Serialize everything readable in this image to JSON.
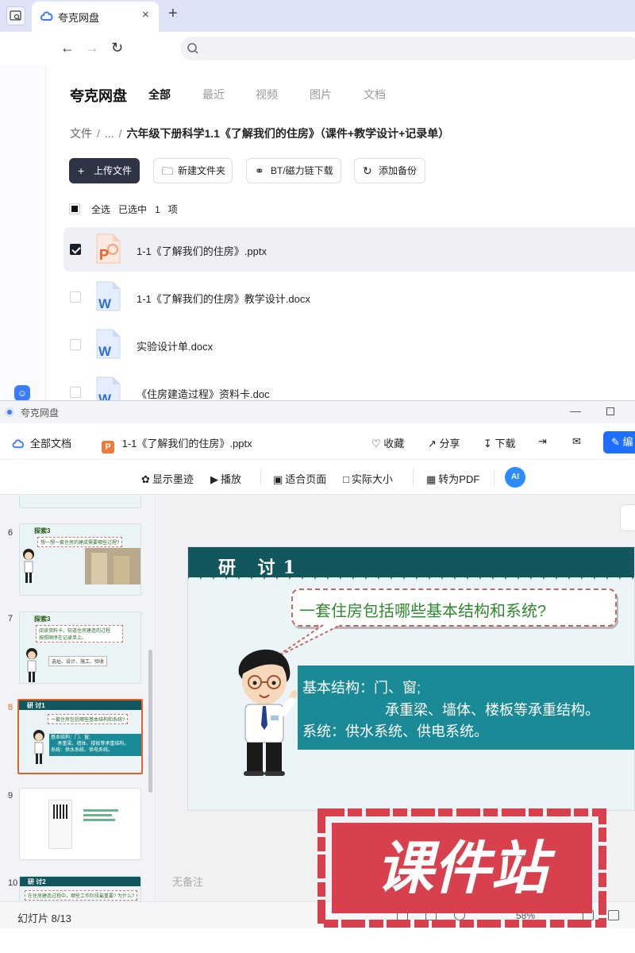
{
  "browser": {
    "tab_title": "夸克网盘",
    "new_tab": "+",
    "close": "×"
  },
  "drive": {
    "brand": "夸克网盘",
    "nav": [
      "全部",
      "最近",
      "视频",
      "图片",
      "文档"
    ],
    "breadcrumb": {
      "root": "文件",
      "mid": "...",
      "current": "六年级下册科学1.1《了解我们的住房》（课件+教学设计+记录单）"
    },
    "actions": {
      "upload": "上传文件",
      "new_folder": "新建文件夹",
      "bt": "BT/磁力链下载",
      "backup": "添加备份"
    },
    "selection": {
      "select_all": "全选",
      "selected": "已选中",
      "count": "1",
      "unit": "项"
    },
    "files": [
      {
        "name": "1-1《了解我们的住房》.pptx",
        "type": "pptx",
        "checked": true
      },
      {
        "name": "1-1《了解我们的住房》教学设计.docx",
        "type": "docx",
        "checked": false
      },
      {
        "name": "实验设计单.docx",
        "type": "docx",
        "checked": false
      },
      {
        "name": "《住房建造过程》资料卡.doc",
        "type": "doc",
        "checked": false
      }
    ]
  },
  "viewer": {
    "window_title": "夸克网盘",
    "all_docs": "全部文档",
    "file_name": "1-1《了解我们的住房》.pptx",
    "file_badge": "P",
    "favorite": "收藏",
    "share": "分享",
    "download": "下载",
    "edit": "编",
    "tools": {
      "ink": "显示墨迹",
      "play": "播放",
      "fit": "适合页面",
      "actual": "实际大小",
      "pdf": "转为PDF",
      "ai": "AI"
    },
    "thumbnails": [
      {
        "num": "6",
        "title": "探索3",
        "bubble": "想一想一套住房的建成需要哪些过程?"
      },
      {
        "num": "7",
        "title": "探索3",
        "bubble": "阅读资料卡，知道住房建造的过程",
        "bubble2": "按照顺序在记录单上。",
        "tag": "选址、设计、施工、验收"
      },
      {
        "num": "8",
        "title": "研 讨1",
        "bubble": "一套住房包括哪些基本结构和系统?",
        "ans1": "基本结构：门、窗;",
        "ans2": "承重梁、墙体、楼板等承重结构。",
        "ans3": "系统：供水系统、供电系统。"
      },
      {
        "num": "9"
      },
      {
        "num": "10",
        "title": "研 讨2",
        "bubble": "在住房建造过程中，哪些工作阶段最重要? 为什么?"
      }
    ],
    "slide": {
      "title": "研 讨1",
      "question": "一套住房包括哪些基本结构和系统?",
      "answer_line1": "基本结构：门、窗;",
      "answer_line2": "承重梁、墙体、楼板等承重结构。",
      "answer_line3": "系统：供水系统、供电系统。"
    },
    "notes": "无备注",
    "status": "幻灯片 8/13",
    "zoom": "58%"
  },
  "watermark": "课件站",
  "colors": {
    "slide_header": "#13575e",
    "answer_box": "#1a8a96",
    "primary_button": "#2f3446",
    "accent_blue": "#1f6fff",
    "selected_thumb": "#e0632b",
    "watermark_red": "#d8404e"
  }
}
